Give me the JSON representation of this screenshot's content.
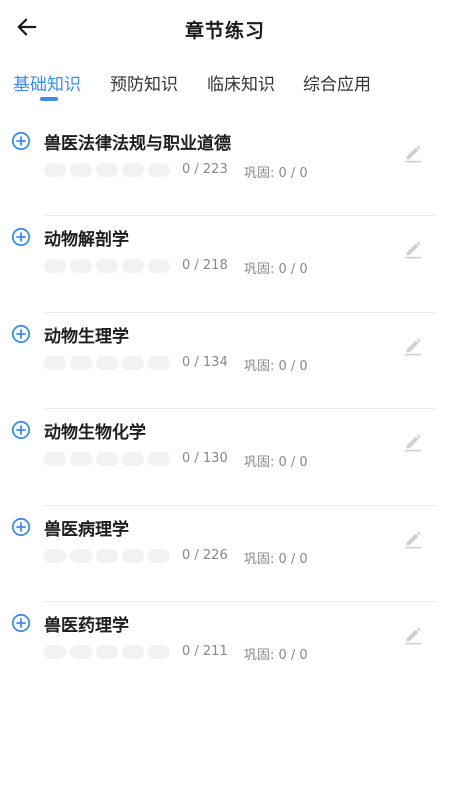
{
  "header": {
    "title": "章节练习",
    "back_icon": "arrow-left-icon"
  },
  "tabs": [
    {
      "label": "基础知识",
      "active": true
    },
    {
      "label": "预防知识",
      "active": false
    },
    {
      "label": "临床知识",
      "active": false
    },
    {
      "label": "综合应用",
      "active": false
    }
  ],
  "colors": {
    "accent": "#3a8ee6",
    "text": "#1e1e1e",
    "muted": "#888888",
    "divider": "#ececec",
    "progress_track": "#f1f2f4",
    "edit_icon": "#c8c8c8"
  },
  "chapters": [
    {
      "title": "兽医法律法规与职业道德",
      "count": "0 / 223",
      "consolidate": "巩固: 0 / 0"
    },
    {
      "title": "动物解剖学",
      "count": "0 / 218",
      "consolidate": "巩固: 0 / 0"
    },
    {
      "title": "动物生理学",
      "count": "0 / 134",
      "consolidate": "巩固: 0 / 0"
    },
    {
      "title": "动物生物化学",
      "count": "0 / 130",
      "consolidate": "巩固: 0 / 0"
    },
    {
      "title": "兽医病理学",
      "count": "0 / 226",
      "consolidate": "巩固: 0 / 0"
    },
    {
      "title": "兽医药理学",
      "count": "0 / 211",
      "consolidate": "巩固: 0 / 0"
    }
  ]
}
